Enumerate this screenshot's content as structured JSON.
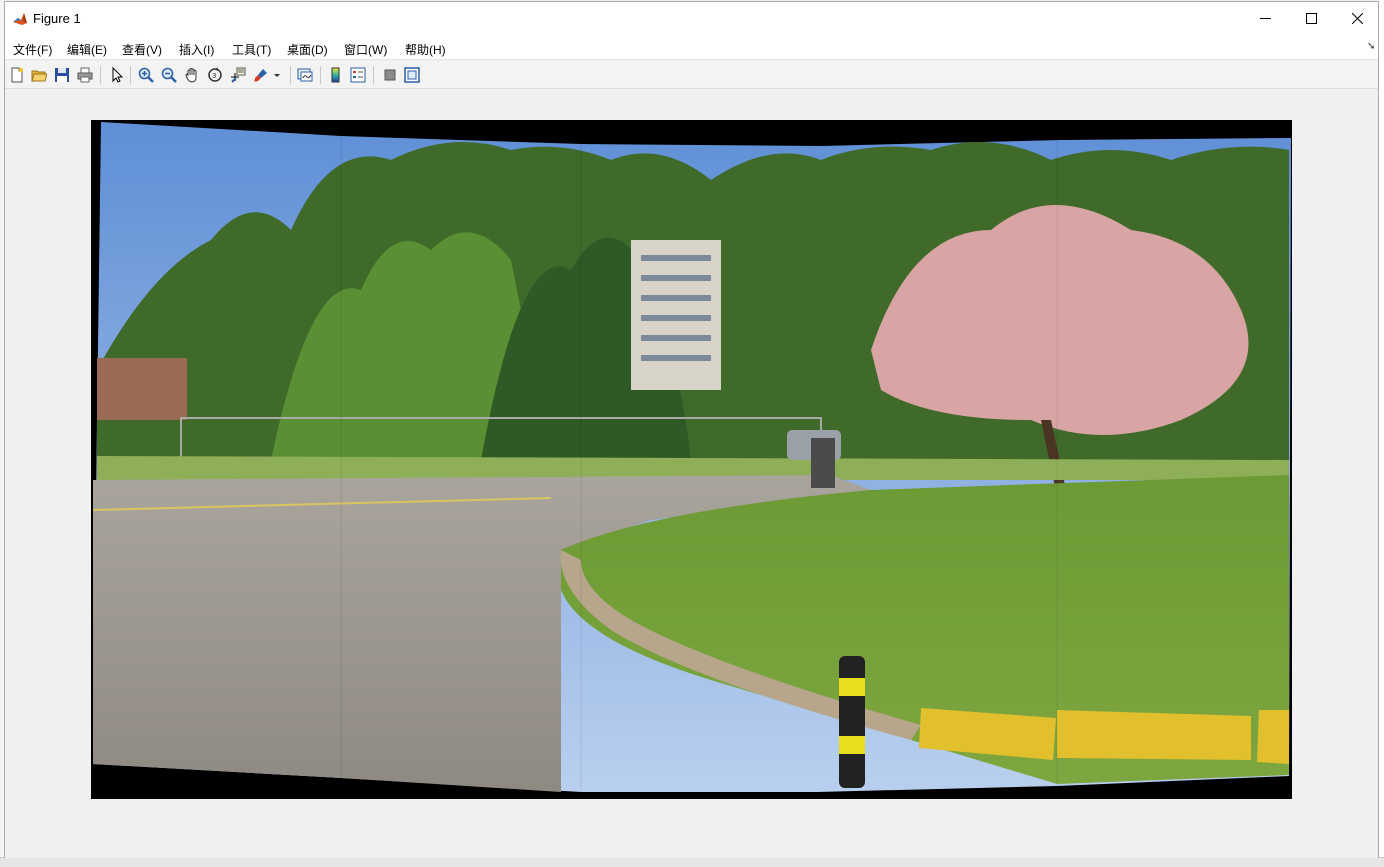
{
  "window": {
    "title": "Figure 1"
  },
  "menu": {
    "items": [
      "文件(F)",
      "编辑(E)",
      "查看(V)",
      "插入(I)",
      "工具(T)",
      "桌面(D)",
      "窗口(W)",
      "帮助(H)"
    ]
  },
  "toolbar": {
    "buttons": [
      "new-figure-icon",
      "open-file-icon",
      "save-icon",
      "print-icon",
      "select-arrow-icon",
      "zoom-in-icon",
      "zoom-out-icon",
      "pan-hand-icon",
      "rotate-3d-icon",
      "data-cursor-icon",
      "brush-icon",
      "link-plot-icon",
      "colorbar-icon",
      "legend-icon",
      "hide-plot-tools-icon",
      "show-plot-tools-icon"
    ]
  },
  "figure": {
    "content": "stitched panorama photo",
    "sky_color": "#7ea6e0",
    "border_color": "#000000"
  },
  "colors": {
    "matlab_icon": "#d9541e",
    "titlebar": "#ffffff",
    "figure_bg": "#f0f0f0"
  }
}
